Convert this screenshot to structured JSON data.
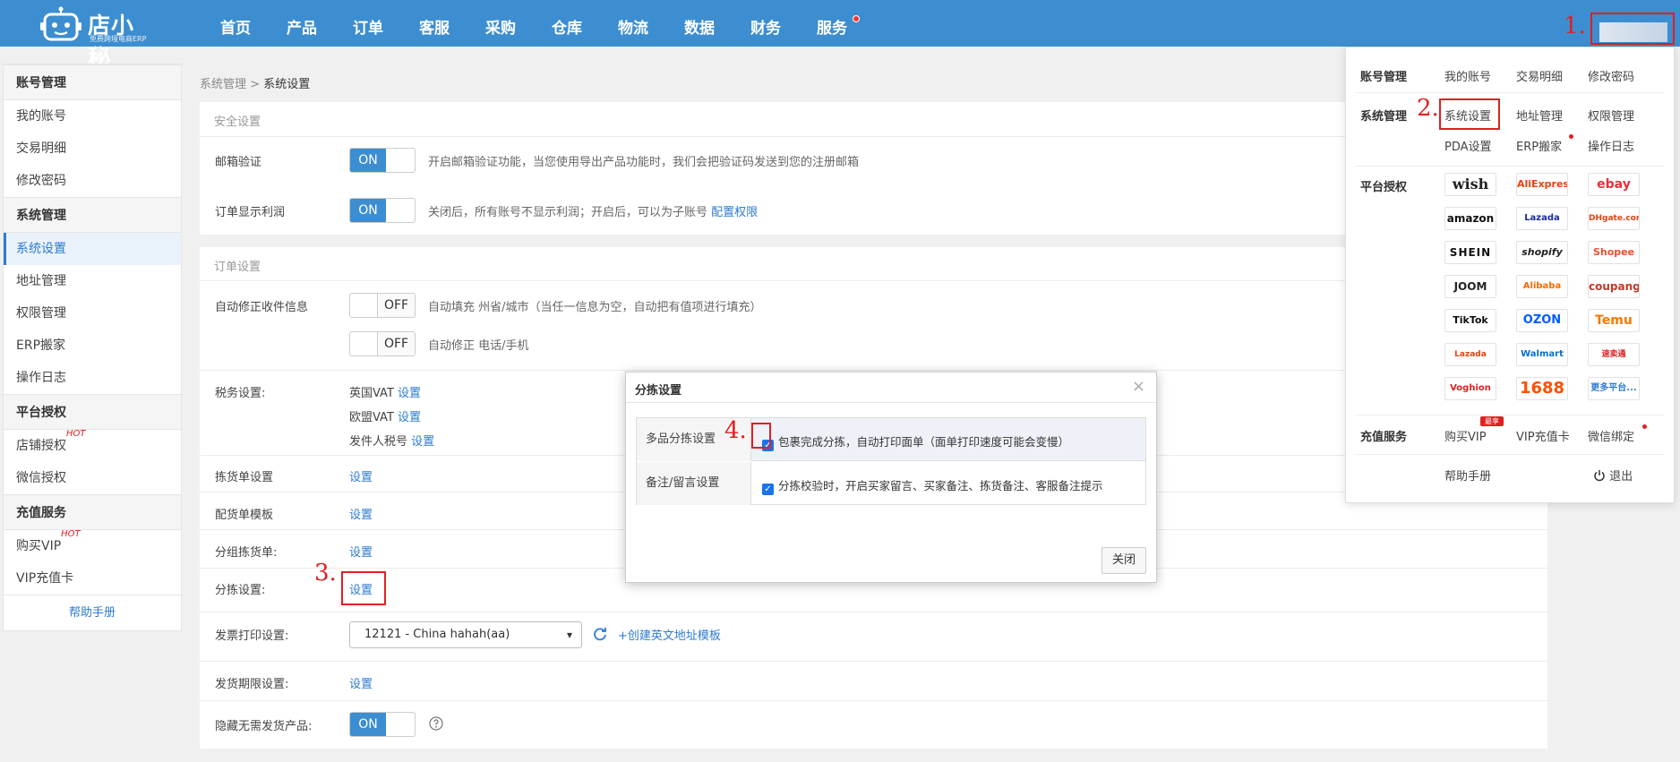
{
  "brand": {
    "title": "店小秘",
    "subtitle": "免费跨境电商ERP",
    "color": "#3d8ed0"
  },
  "nav": [
    "首页",
    "产品",
    "订单",
    "客服",
    "采购",
    "仓库",
    "物流",
    "数据",
    "财务",
    "服务"
  ],
  "annotations": {
    "step1": "1.",
    "step2": "2.",
    "step3": "3.",
    "step4": "4."
  },
  "sidebar": {
    "groups": {
      "account": "账号管理",
      "system": "系统管理",
      "platform": "平台授权",
      "recharge": "充值服务"
    },
    "items": {
      "my_account": "我的账号",
      "transactions": "交易明细",
      "change_password": "修改密码",
      "system_settings": "系统设置",
      "address_mgmt": "地址管理",
      "permission_mgmt": "权限管理",
      "erp_move": "ERP搬家",
      "op_log": "操作日志",
      "store_auth": "店铺授权",
      "wechat_auth": "微信授权",
      "buy_vip": "购买VIP",
      "vip_card": "VIP充值卡"
    },
    "hot": "HOT",
    "help": "帮助手册"
  },
  "breadcrumb": {
    "parent": "系统管理",
    "separator": ">",
    "current": "系统设置"
  },
  "security": {
    "title": "安全设置",
    "email_label": "邮箱验证",
    "email_toggle": "ON",
    "email_desc": "开启邮箱验证功能，当您使用导出产品功能时，我们会把验证码发送到您的注册邮箱",
    "profit_label": "订单显示利润",
    "profit_toggle": "ON",
    "profit_desc": "关闭后，所有账号不显示利润；开启后，可以为子账号",
    "profit_link": "配置权限"
  },
  "order": {
    "title": "订单设置",
    "autofix_label": "自动修正收件信息",
    "autofix_toggle1": "OFF",
    "autofix_desc1": "自动填充 州省/城市（当任一信息为空，自动把有值项进行填充）",
    "autofix_toggle2": "OFF",
    "autofix_desc2": "自动修正 电话/手机",
    "tax_label": "税务设置:",
    "tax_uk": "英国VAT",
    "tax_eu": "欧盟VAT",
    "tax_sender": "发件人税号",
    "set": "设置",
    "picklist_label": "拣货单设置",
    "packing_label": "配货单模板",
    "group_pick_label": "分组拣货单:",
    "sort_label": "分拣设置:",
    "invoice_label": "发票打印设置:",
    "invoice_value": "12121 - China hahah(aa)",
    "invoice_create": "+创建英文地址模板",
    "ship_deadline_label": "发货期限设置:",
    "hide_label": "隐藏无需发货产品:",
    "hide_toggle": "ON"
  },
  "modal": {
    "title": "分拣设置",
    "close_x": "×",
    "rows": [
      {
        "label": "多品分拣设置",
        "text": "包裹完成分拣，自动打印面单（面单打印速度可能会变慢）"
      },
      {
        "label": "备注/留言设置",
        "text": "分拣校验时，开启买家留言、买家备注、拣货备注、客服备注提示"
      }
    ],
    "close_button": "关闭"
  },
  "panel": {
    "account_group": "账号管理",
    "my_account": "我的账号",
    "transactions": "交易明细",
    "change_password": "修改密码",
    "system_group": "系统管理",
    "system_settings": "系统设置",
    "address_mgmt": "地址管理",
    "permission_mgmt": "权限管理",
    "pda": "PDA设置",
    "erp_move": "ERP搬家",
    "op_log": "操作日志",
    "platform_group": "平台授权",
    "platforms": [
      "wish",
      "AliExpress",
      "ebay",
      "amazon",
      "Lazada",
      "DHgate.com",
      "SHEIN",
      "shopify",
      "Shopee",
      "JOOM",
      "Alibaba",
      "coupang",
      "TikTok",
      "OZON",
      "Temu",
      "Lazada",
      "Walmart",
      "速卖通",
      "Voghion",
      "1688",
      "更多平台..."
    ],
    "recharge_group": "充值服务",
    "buy_vip": "购买VIP",
    "vip_badge": "最享",
    "vip_card": "VIP充值卡",
    "wechat_bind": "微信绑定",
    "help": "帮助手册",
    "logout": "退出"
  }
}
